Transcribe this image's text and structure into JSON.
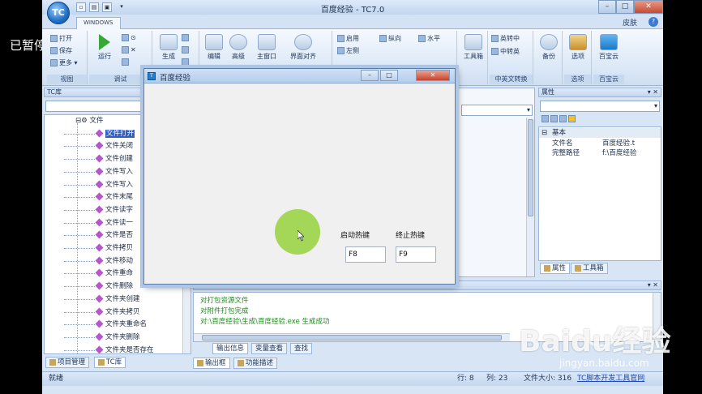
{
  "overlay": {
    "paused": "已暂停"
  },
  "app": {
    "title": "百度经验 - TC7.0",
    "orb_label": "TC",
    "ribbon_tab": "WINDOWS",
    "skin": "皮肤",
    "help": "?"
  },
  "window_buttons": {
    "minimize": "–",
    "maximize": "□",
    "close": "✕"
  },
  "ribbon": {
    "groups": [
      {
        "label": "视图",
        "items": [
          "打开",
          "保存",
          "更多"
        ]
      },
      {
        "label": "调试",
        "items": [
          "运行"
        ]
      },
      {
        "label": "",
        "items": [
          "生成"
        ]
      },
      {
        "label": "",
        "items": [
          "编辑",
          "高级",
          "主窗口",
          "界面对齐"
        ]
      },
      {
        "label": "",
        "items": [
          "启用",
          "左侧",
          "纵向",
          "水平"
        ]
      },
      {
        "label": "",
        "items": [
          "工具箱"
        ]
      },
      {
        "label": "中英文转换",
        "items": [
          "英转中",
          "中转英"
        ]
      },
      {
        "label": "",
        "items": [
          "备份"
        ]
      },
      {
        "label": "选项",
        "items": [
          "选项"
        ]
      },
      {
        "label": "百宝云",
        "items": [
          "百宝云"
        ]
      }
    ]
  },
  "tc_library": {
    "title": "TC库",
    "root": "文件",
    "selected_index": 0,
    "items": [
      "文件打开",
      "文件关闭",
      "文件创建",
      "文件写入",
      "文件写入",
      "文件末尾",
      "文件读字",
      "文件读一",
      "文件是否",
      "文件拷贝",
      "文件移动",
      "文件重命",
      "文件删除",
      "文件夹创建",
      "文件夹拷贝",
      "文件夹重命名",
      "文件夹删除",
      "文件夹是否存在"
    ]
  },
  "left_tabs": [
    "项目管理",
    "TC库"
  ],
  "properties": {
    "title": "属性",
    "section": "基本",
    "rows": [
      {
        "key": "文件名",
        "value": "百度经验.t"
      },
      {
        "key": "完整路径",
        "value": "f:\\百度经验"
      }
    ],
    "tabs": [
      "属性",
      "工具箱"
    ]
  },
  "output": {
    "title": "输出框",
    "lines": [
      "对打包资源文件",
      "对附件打包完成",
      "对:\\百度经验\\生成\\百度经验.exe 生成成功"
    ],
    "tabs": [
      "输出信息",
      "变量查看",
      "查找"
    ],
    "bottom_tabs": [
      "输出框",
      "功能描述"
    ]
  },
  "status": {
    "ready": "就绪",
    "line": "行: 8",
    "col": "列: 23",
    "filesize": "文件大小: 316",
    "link": "TC脚本开发工具官网"
  },
  "dialog": {
    "title": "百度经验",
    "start_label": "启动热键",
    "stop_label": "终止热键",
    "start_value": "F8",
    "stop_value": "F9"
  },
  "watermark": {
    "text": "Baidu经验",
    "url": "jingyan.baidu.com"
  }
}
